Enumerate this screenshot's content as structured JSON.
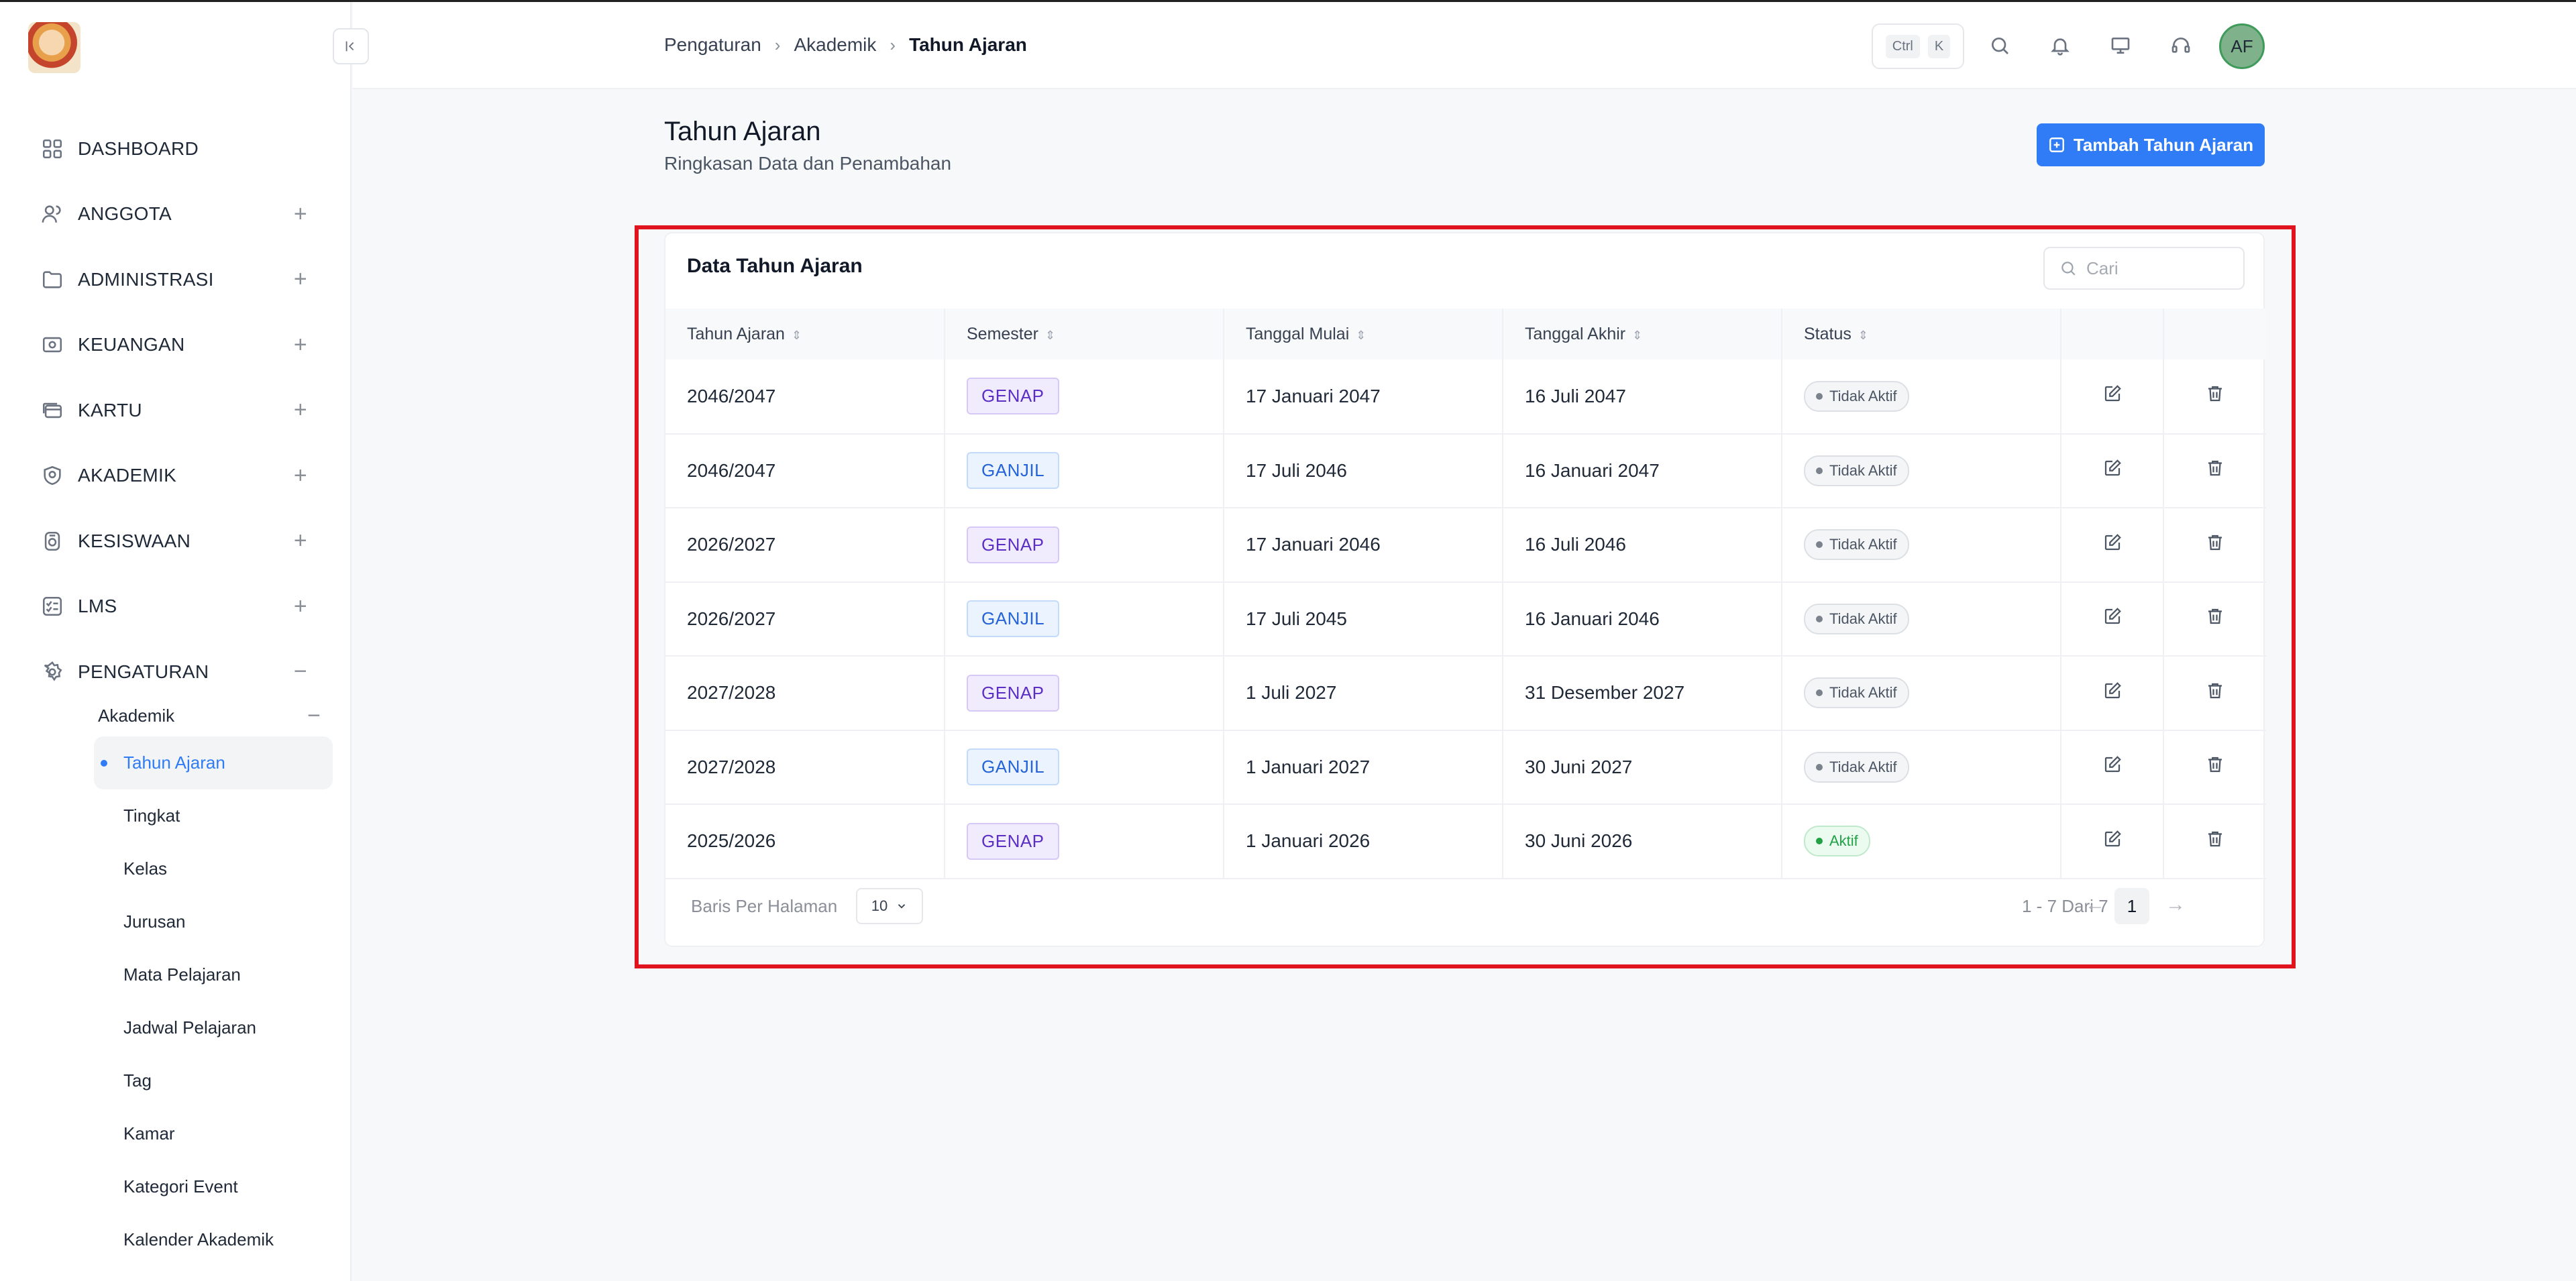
{
  "sidebar": {
    "items": [
      {
        "label": "DASHBOARD",
        "icon": "grid-icon",
        "toggle": ""
      },
      {
        "label": "ANGGOTA",
        "icon": "users-icon",
        "toggle": "+"
      },
      {
        "label": "ADMINISTRASI",
        "icon": "folder-icon",
        "toggle": "+"
      },
      {
        "label": "KEUANGAN",
        "icon": "cash-icon",
        "toggle": "+"
      },
      {
        "label": "KARTU",
        "icon": "card-icon",
        "toggle": "+"
      },
      {
        "label": "AKADEMIK",
        "icon": "book-icon",
        "toggle": "+"
      },
      {
        "label": "KESISWAAN",
        "icon": "medal-icon",
        "toggle": "+"
      },
      {
        "label": "LMS",
        "icon": "checklist-icon",
        "toggle": "+"
      },
      {
        "label": "PENGATURAN",
        "icon": "gear-icon",
        "toggle": "−"
      }
    ],
    "submenu": {
      "label": "Akademik",
      "toggle": "−",
      "items": [
        "Tahun Ajaran",
        "Tingkat",
        "Kelas",
        "Jurusan",
        "Mata Pelajaran",
        "Jadwal Pelajaran",
        "Tag",
        "Kamar",
        "Kategori Event",
        "Kalender Akademik"
      ]
    }
  },
  "header": {
    "breadcrumb": [
      "Pengaturan",
      "Akademik",
      "Tahun Ajaran"
    ],
    "shortcut": {
      "key1": "Ctrl",
      "key2": "K"
    },
    "avatar_initials": "AF"
  },
  "page": {
    "title": "Tahun Ajaran",
    "subtitle": "Ringkasan Data dan Penambahan",
    "add_button": "Tambah Tahun Ajaran"
  },
  "card": {
    "title": "Data Tahun Ajaran",
    "search_placeholder": "Cari",
    "columns": [
      "Tahun Ajaran",
      "Semester",
      "Tanggal Mulai",
      "Tanggal Akhir",
      "Status"
    ],
    "rows": [
      {
        "year": "2046/2047",
        "semester": "GENAP",
        "start": "17 Januari 2047",
        "end": "16 Juli 2047",
        "status": "Tidak Aktif"
      },
      {
        "year": "2046/2047",
        "semester": "GANJIL",
        "start": "17 Juli 2046",
        "end": "16 Januari 2047",
        "status": "Tidak Aktif"
      },
      {
        "year": "2026/2027",
        "semester": "GENAP",
        "start": "17 Januari 2046",
        "end": "16 Juli 2046",
        "status": "Tidak Aktif"
      },
      {
        "year": "2026/2027",
        "semester": "GANJIL",
        "start": "17 Juli 2045",
        "end": "16 Januari 2046",
        "status": "Tidak Aktif"
      },
      {
        "year": "2027/2028",
        "semester": "GENAP",
        "start": "1 Juli 2027",
        "end": "31 Desember 2027",
        "status": "Tidak Aktif"
      },
      {
        "year": "2027/2028",
        "semester": "GANJIL",
        "start": "1 Januari 2027",
        "end": "30 Juni 2027",
        "status": "Tidak Aktif"
      },
      {
        "year": "2025/2026",
        "semester": "GENAP",
        "start": "1 Januari 2026",
        "end": "30 Juni 2026",
        "status": "Aktif"
      }
    ],
    "footer": {
      "rows_per_page_label": "Baris Per Halaman",
      "rows_per_page_value": "10",
      "range": "1 - 7 Dari 7",
      "current_page": "1",
      "prev": "←",
      "next": "→"
    }
  },
  "colors": {
    "accent": "#2f7cf6",
    "highlight_frame": "#e0141e",
    "status_active": "#22a146",
    "status_inactive": "#7b828c",
    "genap": "#5b2fc4",
    "ganjil": "#2563d8"
  }
}
